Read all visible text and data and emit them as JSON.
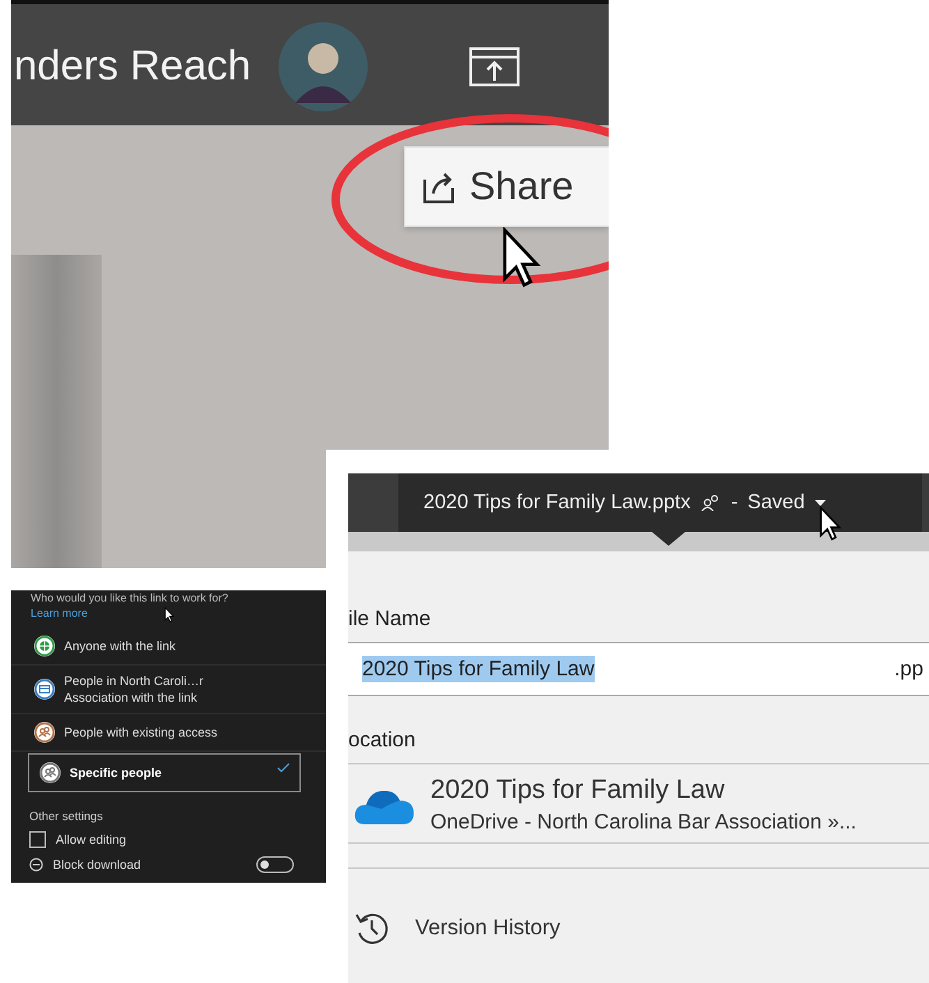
{
  "account_bar": {
    "name": "nders Reach",
    "share_button": "Share"
  },
  "link_settings": {
    "prompt": "Who would you like this link to work for?",
    "learn_more": "Learn more",
    "options": [
      {
        "label": "Anyone with the link",
        "kind": "globe",
        "selected": false
      },
      {
        "label": "People in North Caroli…r Association with the link",
        "kind": "org",
        "selected": false
      },
      {
        "label": "People with existing access",
        "kind": "group",
        "selected": false
      },
      {
        "label": "Specific people",
        "kind": "people",
        "selected": true
      }
    ],
    "other_settings": "Other settings",
    "allow_editing": {
      "label": "Allow editing",
      "checked": false
    },
    "block_download": {
      "label": "Block download",
      "on": false
    }
  },
  "file_panel": {
    "title": "2020 Tips for Family Law.pptx",
    "separator": "-",
    "status": "Saved",
    "file_name_label": "ile Name",
    "file_name": "2020 Tips for Family Law",
    "extension": ".pp",
    "location_label": "ocation",
    "location_name": "2020 Tips for Family Law",
    "location_path": "OneDrive - North Carolina Bar Association »...",
    "version_history": "Version History"
  }
}
